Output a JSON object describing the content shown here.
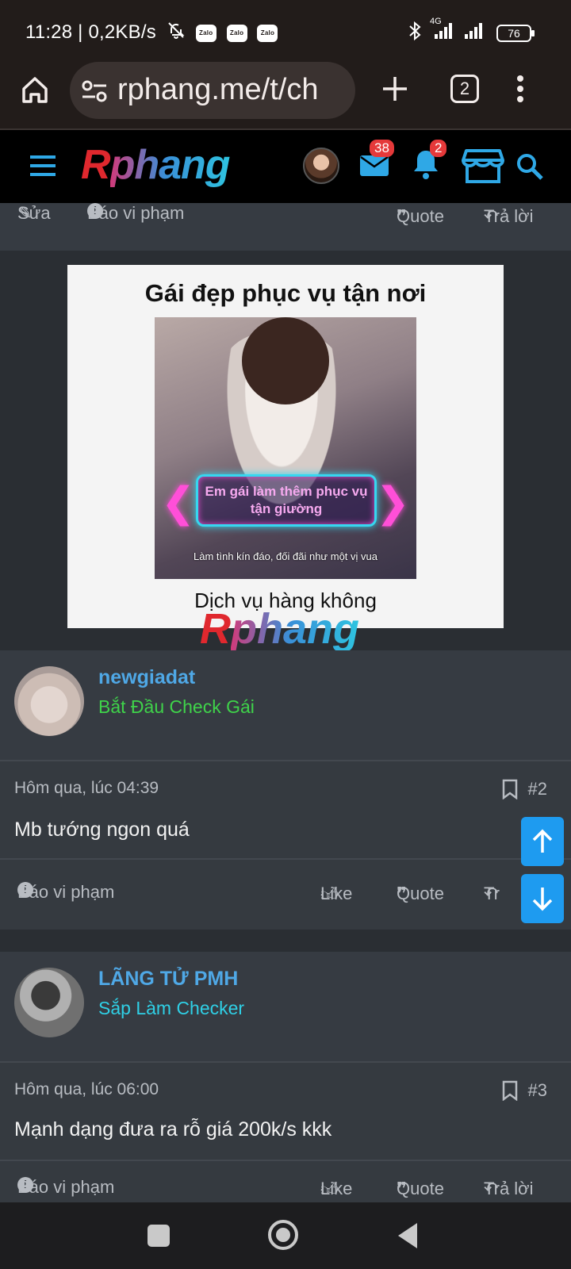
{
  "status_bar": {
    "time": "11:28 | 0,2KB/s",
    "zalo_label": "Zalo",
    "network": "4G",
    "battery": "76"
  },
  "browser": {
    "url": "rphang.me/t/ch",
    "tab_count": "2"
  },
  "site_header": {
    "logo_first": "R",
    "logo_rest": "phang",
    "messages_badge": "38",
    "alerts_badge": "2"
  },
  "top_actions": {
    "edit": "Sửa",
    "report": "Báo vi phạm",
    "quote": "Quote",
    "reply": "Trả lời"
  },
  "ad": {
    "title": "Gái đẹp phục vụ tận nơi",
    "neon_text": "Em gái làm thêm phục vụ tận giường",
    "neon_sub": "Làm tình kín đáo, đối đãi như một vị vua",
    "caption": "Dịch vụ hàng không",
    "watermark_first": "R",
    "watermark_rest": "phang"
  },
  "posts": [
    {
      "username": "newgiadat",
      "user_title": "Bắt Đầu Check Gái",
      "user_title_color": "#3fd34a",
      "date": "Hôm qua, lúc 04:39",
      "number": "#2",
      "content": "Mb tướng ngon quá",
      "report": "Báo vi phạm",
      "like": "Like",
      "quote": "Quote",
      "reply": "Tr"
    },
    {
      "username": "LÃNG TỬ PMH",
      "user_title": "Sắp Làm Checker",
      "user_title_color": "#2fd0e6",
      "date": "Hôm qua, lúc 06:00",
      "number": "#3",
      "content": "Mạnh dạng đưa ra rỗ giá 200k/s kkk",
      "report": "Báo vi phạm",
      "like": "Like",
      "quote": "Quote",
      "reply": "Trả lời"
    }
  ],
  "icons": {
    "bell_muted": "bell-off-icon",
    "bluetooth": "bluetooth-icon",
    "home": "home-icon",
    "site_settings": "tune-icon",
    "new_tab": "plus-icon",
    "tabs": "tabs-icon",
    "menu": "kebab-menu-icon",
    "hamburger": "hamburger-icon",
    "mail": "mail-icon",
    "bell": "bell-icon",
    "store": "store-icon",
    "search": "search-icon",
    "pencil": "pencil-icon",
    "alert": "alert-circle-icon",
    "quote": "quote-icon",
    "reply": "reply-icon",
    "like": "thumbs-up-icon",
    "bookmark": "bookmark-icon",
    "arrow_up": "arrow-up-icon",
    "arrow_down": "arrow-down-icon",
    "nav_recents": "square-icon",
    "nav_home": "circle-icon",
    "nav_back": "triangle-back-icon"
  },
  "colors": {
    "accent_blue": "#1e9bf0",
    "username_blue": "#4fa8e6",
    "badge_red": "#e5393a"
  }
}
